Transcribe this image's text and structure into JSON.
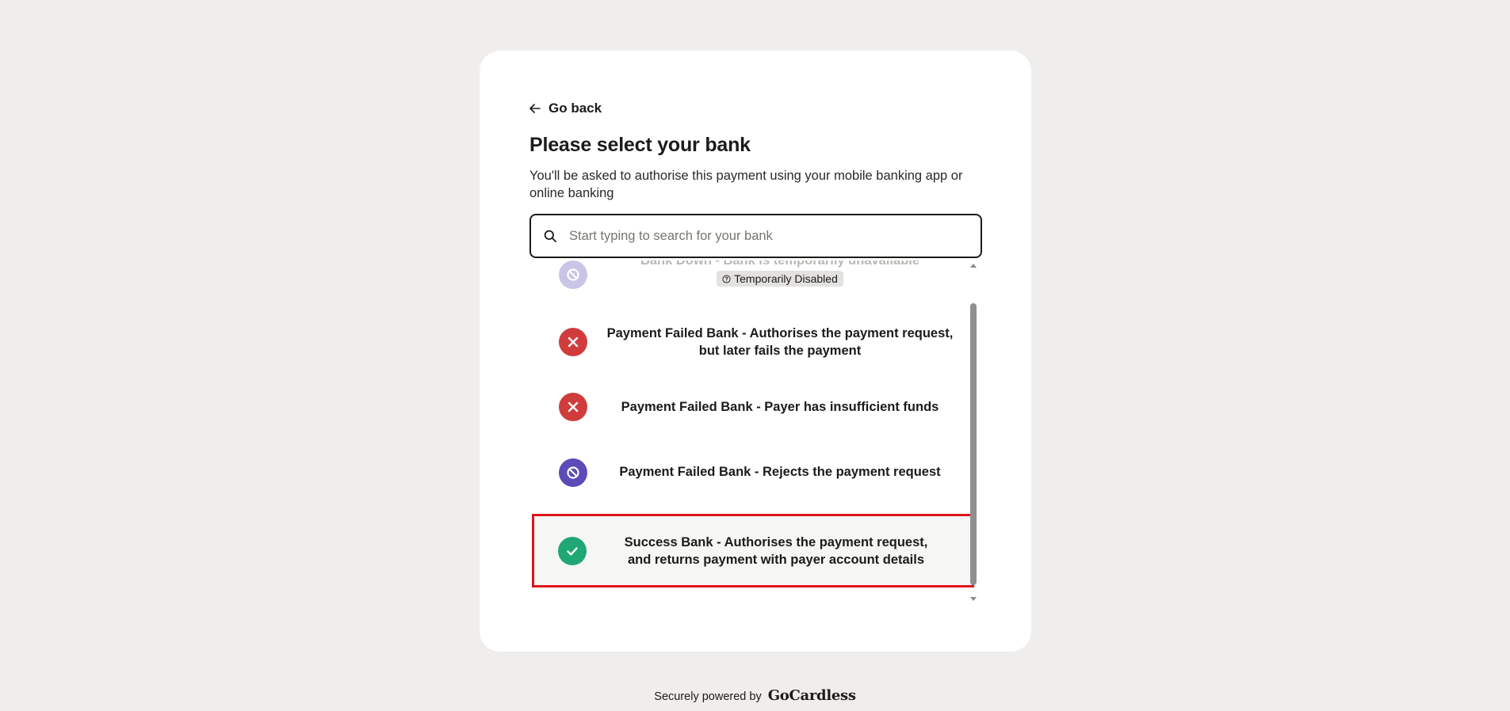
{
  "nav": {
    "back_label": "Go back"
  },
  "page": {
    "title": "Please select your bank",
    "subtitle": "You'll be asked to authorise this payment using your mobile banking app or online banking"
  },
  "search": {
    "placeholder": "Start typing to search for your bank",
    "value": ""
  },
  "banks": [
    {
      "label": "Bank Down - Bank is temporarily unavailable",
      "badge": "Temporarily Disabled",
      "icon": "block-icon",
      "status": "disabled",
      "color": "#c9c5e6"
    },
    {
      "label": "Payment Failed Bank - Authorises the payment request, but later fails the payment",
      "icon": "cross-icon",
      "status": "failed",
      "color": "#d03c3c"
    },
    {
      "label": "Payment Failed Bank - Payer has insufficient funds",
      "icon": "cross-icon",
      "status": "failed",
      "color": "#d03c3c"
    },
    {
      "label": "Payment Failed Bank - Rejects the payment request",
      "icon": "block-icon",
      "status": "rejected",
      "color": "#5b4cb8"
    },
    {
      "label": "Success Bank - Authorises the payment request, and returns payment with payer account details",
      "icon": "check-icon",
      "status": "success",
      "color": "#1fa774"
    }
  ],
  "footer": {
    "powered_by": "Securely powered by",
    "brand": "GoCardless"
  },
  "colors": {
    "highlight": "#e0141c",
    "background": "#efeeed"
  }
}
